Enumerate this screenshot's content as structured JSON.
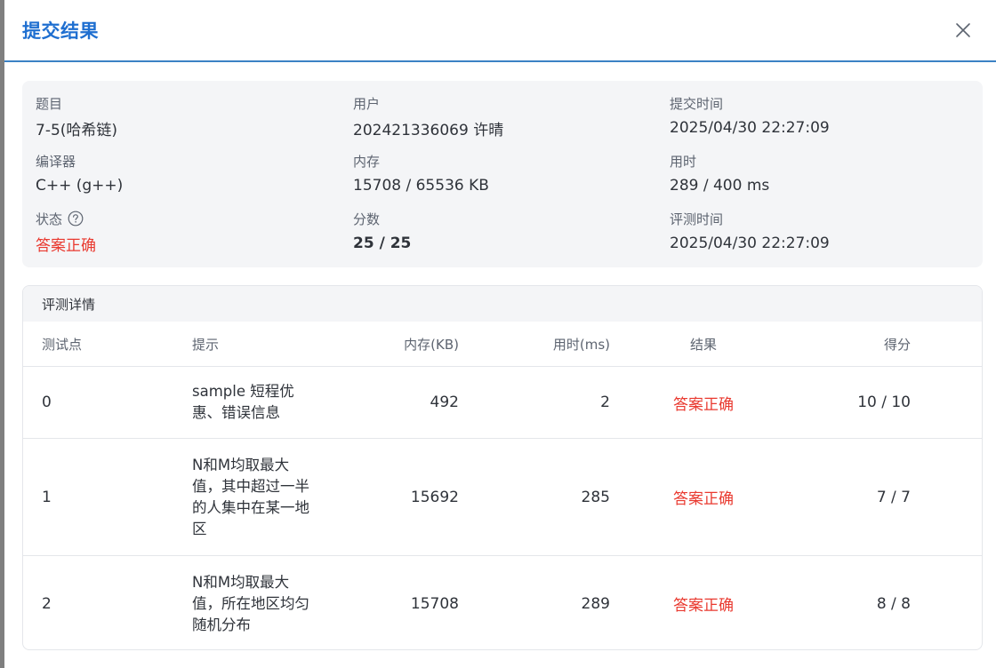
{
  "dialog": {
    "title": "提交结果"
  },
  "info": {
    "problem_label": "题目",
    "problem_value": "7-5(哈希链)",
    "user_label": "用户",
    "user_value": "202421336069 许晴",
    "submit_time_label": "提交时间",
    "submit_time_value": "2025/04/30 22:27:09",
    "compiler_label": "编译器",
    "compiler_value": "C++ (g++)",
    "memory_label": "内存",
    "memory_value": "15708 / 65536 KB",
    "time_label": "用时",
    "time_value": "289 / 400 ms",
    "status_label": "状态",
    "status_value": "答案正确",
    "score_label": "分数",
    "score_value": "25 / 25",
    "judge_time_label": "评测时间",
    "judge_time_value": "2025/04/30 22:27:09"
  },
  "details": {
    "title": "评测详情",
    "headers": {
      "id": "测试点",
      "hint": "提示",
      "memory": "内存(KB)",
      "time": "用时(ms)",
      "result": "结果",
      "score": "得分"
    },
    "rows": [
      {
        "id": "0",
        "hint": "sample 短程优惠、错误信息",
        "memory": "492",
        "time": "2",
        "result": "答案正确",
        "score": "10 / 10"
      },
      {
        "id": "1",
        "hint": "N和M均取最大值，其中超过一半的人集中在某一地区",
        "memory": "15692",
        "time": "285",
        "result": "答案正确",
        "score": "7 / 7"
      },
      {
        "id": "2",
        "hint": "N和M均取最大值，所在地区均匀随机分布",
        "memory": "15708",
        "time": "289",
        "result": "答案正确",
        "score": "8 / 8"
      }
    ]
  },
  "colors": {
    "title": "#1f6fd0",
    "accepted": "#e9392f",
    "header_line": "#3b82c4"
  },
  "icons": {
    "close": "close-icon",
    "help": "question-circle-icon"
  }
}
